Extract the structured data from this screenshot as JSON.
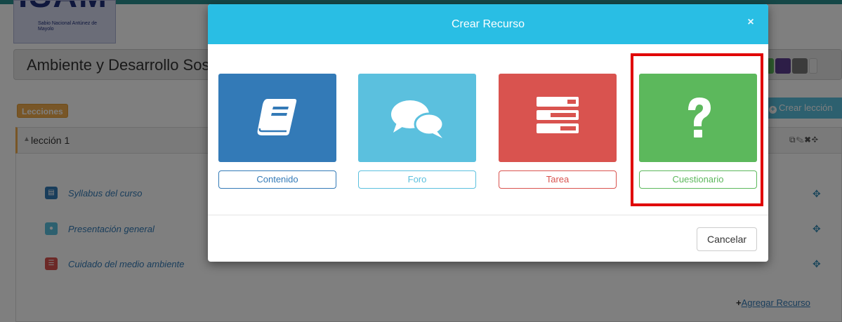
{
  "background": {
    "logo": {
      "mark": "ISAM",
      "subtitle": "Sabio Nacional Antúnez de Mayolo"
    },
    "course_title": "Ambiente y Desarrollo Sostenible",
    "lessons_badge": "Lecciones",
    "create_lesson_button": "Crear lección",
    "lesson": {
      "title": "lección 1",
      "tools": "⧉✎✖✥",
      "resources": [
        {
          "label": "Syllabus del curso",
          "icon": "book-icon",
          "color": "#337ab7"
        },
        {
          "label": "Presentación general",
          "icon": "chat-bubbles-icon",
          "color": "#5bc0de"
        },
        {
          "label": "Cuidado del medio ambiente",
          "icon": "tasks-icon",
          "color": "#d9534f"
        }
      ]
    },
    "add_resource_link": "Agregar Recurso"
  },
  "modal": {
    "title": "Crear Recurso",
    "close_icon": "×",
    "resource_types": [
      {
        "label": "Contenido",
        "icon": "book-icon",
        "color": "#337ab7"
      },
      {
        "label": "Foro",
        "icon": "chat-bubbles-icon",
        "color": "#5bc0de"
      },
      {
        "label": "Tarea",
        "icon": "tasks-icon",
        "color": "#d9534f"
      },
      {
        "label": "Cuestionario",
        "icon": "question-mark-icon",
        "color": "#5cb85c",
        "highlighted": true
      }
    ],
    "cancel_button": "Cancelar"
  },
  "colors": {
    "modal_header": "#29bee4",
    "highlight": "#e00000",
    "badge": "#f0ad4e"
  }
}
